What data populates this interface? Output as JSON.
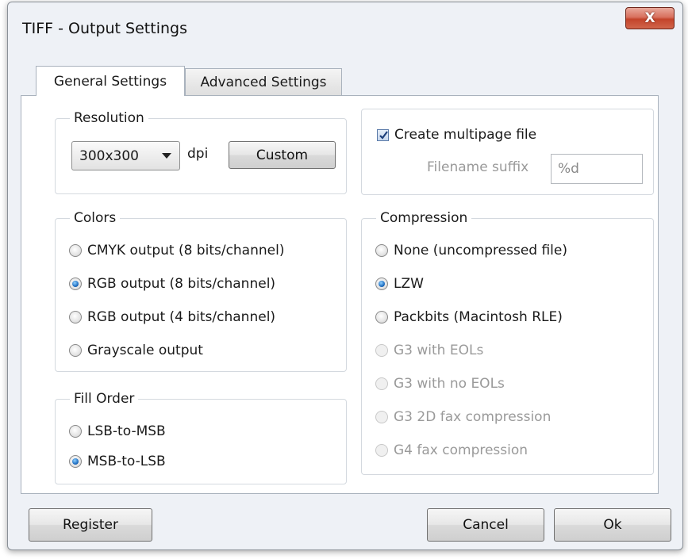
{
  "window": {
    "title": "TIFF - Output Settings",
    "close_glyph": "X"
  },
  "tabs": [
    {
      "label": "General Settings",
      "active": true
    },
    {
      "label": "Advanced Settings",
      "active": false
    }
  ],
  "resolution": {
    "legend": "Resolution",
    "selected": "300x300",
    "unit": "dpi",
    "custom_label": "Custom"
  },
  "multipage": {
    "checkbox_label": "Create multipage file",
    "checked": true,
    "suffix_label": "Filename suffix",
    "suffix_value": "%d"
  },
  "colors": {
    "legend": "Colors",
    "options": [
      {
        "label": "CMYK output (8 bits/channel)",
        "checked": false
      },
      {
        "label": "RGB output (8 bits/channel)",
        "checked": true
      },
      {
        "label": "RGB output (4 bits/channel)",
        "checked": false
      },
      {
        "label": "Grayscale output",
        "checked": false
      }
    ]
  },
  "fill_order": {
    "legend": "Fill Order",
    "options": [
      {
        "label": "LSB-to-MSB",
        "checked": false
      },
      {
        "label": "MSB-to-LSB",
        "checked": true
      }
    ]
  },
  "compression": {
    "legend": "Compression",
    "options": [
      {
        "label": "None (uncompressed file)",
        "checked": false,
        "enabled": true
      },
      {
        "label": "LZW",
        "checked": true,
        "enabled": true
      },
      {
        "label": "Packbits (Macintosh RLE)",
        "checked": false,
        "enabled": true
      },
      {
        "label": "G3 with EOLs",
        "checked": false,
        "enabled": false
      },
      {
        "label": "G3 with no EOLs",
        "checked": false,
        "enabled": false
      },
      {
        "label": "G3 2D fax compression",
        "checked": false,
        "enabled": false
      },
      {
        "label": "G4 fax compression",
        "checked": false,
        "enabled": false
      }
    ]
  },
  "buttons": {
    "register": "Register",
    "cancel": "Cancel",
    "ok": "Ok"
  },
  "colors_theme": {
    "accent": "#1f6fc2",
    "close_red": "#c4442b",
    "disabled": "#9a9a9a"
  }
}
